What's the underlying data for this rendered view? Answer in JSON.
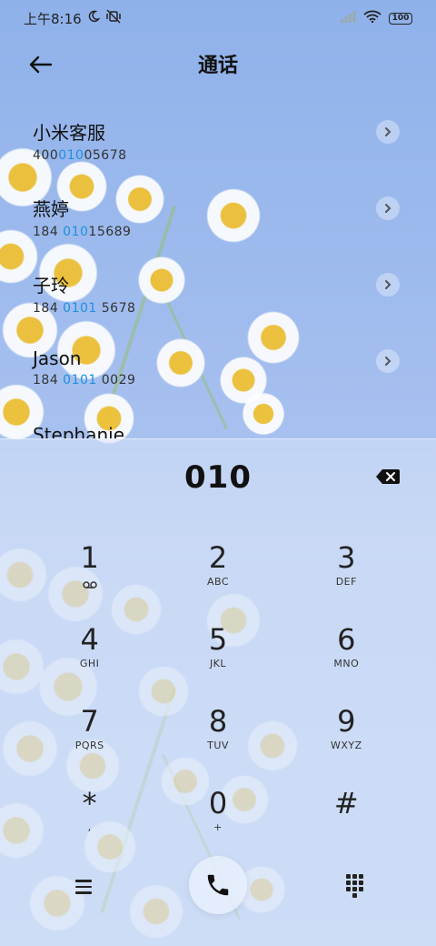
{
  "status_bar": {
    "time": "上午8:16",
    "battery": "100"
  },
  "header": {
    "title": "通话"
  },
  "contacts": [
    {
      "name": "小米客服",
      "number_parts": [
        "400",
        "010",
        "05678"
      ]
    },
    {
      "name": "燕婷",
      "number_parts": [
        "184 ",
        "010",
        "15689"
      ]
    },
    {
      "name": "子玲",
      "number_parts": [
        "184 ",
        "0101",
        " 5678"
      ]
    },
    {
      "name": "Jason",
      "number_parts": [
        "184 ",
        "0101",
        " 0029"
      ]
    },
    {
      "name": "Stephanie",
      "number_parts": [
        "",
        "",
        ""
      ]
    }
  ],
  "dialer": {
    "input_value": "010",
    "keys": [
      {
        "digit": "1",
        "letters": ""
      },
      {
        "digit": "2",
        "letters": "ABC"
      },
      {
        "digit": "3",
        "letters": "DEF"
      },
      {
        "digit": "4",
        "letters": "GHI"
      },
      {
        "digit": "5",
        "letters": "JKL"
      },
      {
        "digit": "6",
        "letters": "MNO"
      },
      {
        "digit": "7",
        "letters": "PQRS"
      },
      {
        "digit": "8",
        "letters": "TUV"
      },
      {
        "digit": "9",
        "letters": "WXYZ"
      },
      {
        "digit": "*",
        "letters": ","
      },
      {
        "digit": "0",
        "letters": "+"
      },
      {
        "digit": "#",
        "letters": ""
      }
    ]
  },
  "colors": {
    "highlight": "#1f8fe0",
    "text": "#222222"
  }
}
